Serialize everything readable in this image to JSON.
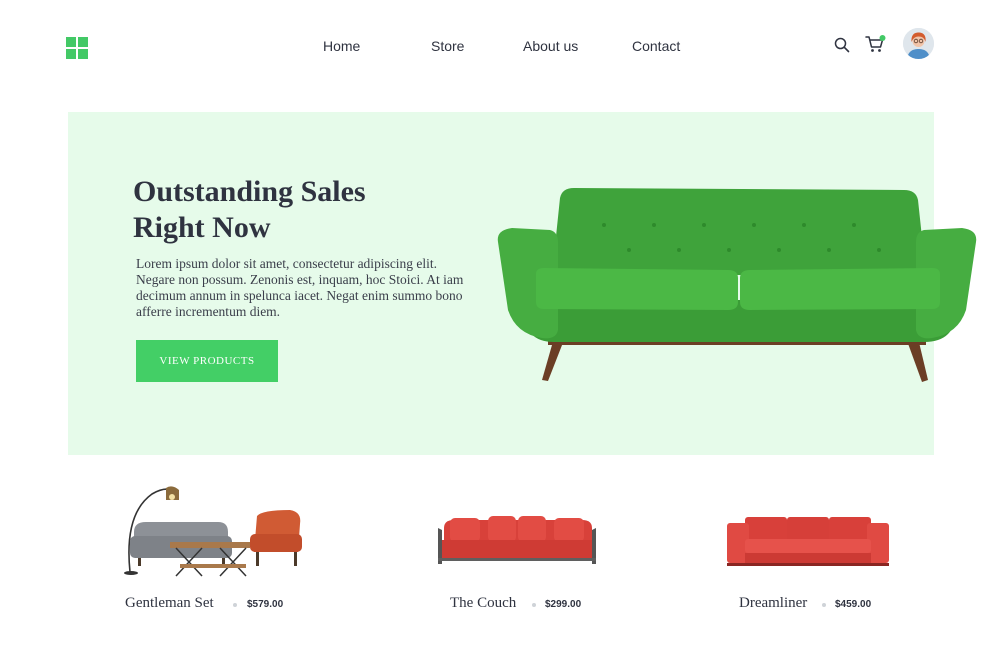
{
  "header": {
    "logo_icon": "grid-logo-icon",
    "nav": [
      "Home",
      "Store",
      "About us",
      "Contact"
    ],
    "search_icon": "search-icon",
    "cart_icon": "cart-icon",
    "cart_badge_color": "#43c966",
    "avatar": "user-avatar"
  },
  "hero": {
    "title_line1": "Outstanding Sales",
    "title_line2": "Right Now",
    "body": "Lorem ipsum dolor sit amet, consectetur adipiscing elit. Negare non possum. Zenonis est, inquam, hoc Stoici. At iam decimum annum in spelunca iacet. Negat enim summo bono afferre incrementum diem.",
    "cta": "VIEW PRODUCTS",
    "background": "#e6fbea",
    "accent": "#43cf66"
  },
  "products": [
    {
      "name": "Gentleman Set",
      "price": "$579.00"
    },
    {
      "name": "The Couch",
      "price": "$299.00"
    },
    {
      "name": "Dreamliner",
      "price": "$459.00"
    }
  ]
}
